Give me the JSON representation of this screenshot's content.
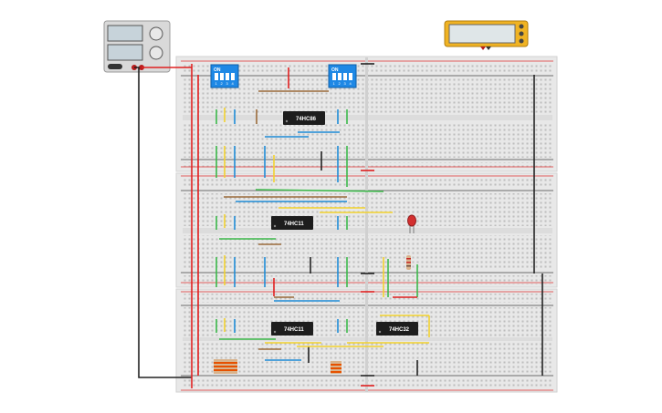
{
  "colors": {
    "board": "#e9e9e9",
    "board_edge": "#d6d6d6",
    "hole": "#b9b9b9",
    "rail_red": "#e03030",
    "rail_black": "#333333",
    "chip": "#1d1d1d",
    "dip_switch": "#1e88e5",
    "psu_body": "#d8d8d8",
    "multimeter_body": "#f0b323",
    "led": "#d32f2f",
    "wire_red": "#e02020",
    "wire_black": "#222222",
    "wire_blue": "#1e8bd6",
    "wire_green": "#3cb84a",
    "wire_yellow": "#f2d22e",
    "wire_brown": "#9a6a3a"
  },
  "components": {
    "power_supply": {
      "name": "power-supply-icon"
    },
    "multimeter": {
      "name": "multimeter-icon"
    },
    "dip_switches": [
      {
        "on_label": "ON",
        "numbers": [
          "1",
          "2",
          "3",
          "4"
        ]
      },
      {
        "on_label": "ON",
        "numbers": [
          "1",
          "2",
          "3",
          "4"
        ]
      }
    ],
    "chips": [
      {
        "label": "74HC86"
      },
      {
        "label": "74HC11"
      },
      {
        "label": "74HC11"
      },
      {
        "label": "74HC32"
      }
    ],
    "led": {
      "name": "led-icon"
    }
  }
}
